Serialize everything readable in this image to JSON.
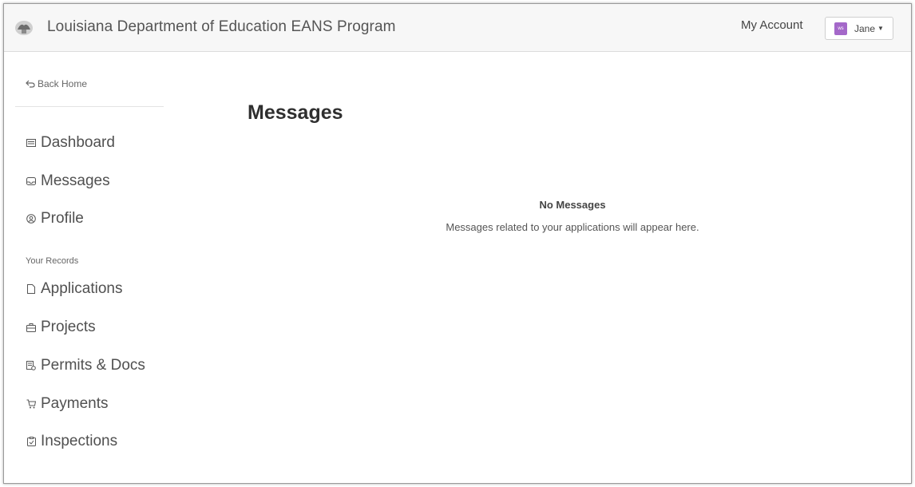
{
  "header": {
    "app_title": "Louisiana Department of Education EANS Program",
    "my_account": "My Account",
    "user_name": "Jane",
    "avatar_initials": "ws",
    "avatar_color": "#a468c9"
  },
  "sidebar": {
    "back_home": "Back Home",
    "primary_items": [
      {
        "label": "Dashboard",
        "icon": "dashboard-icon"
      },
      {
        "label": "Messages",
        "icon": "inbox-icon"
      },
      {
        "label": "Profile",
        "icon": "user-circle-icon"
      }
    ],
    "section_label": "Your Records",
    "record_items": [
      {
        "label": "Applications",
        "icon": "document-icon"
      },
      {
        "label": "Projects",
        "icon": "briefcase-icon"
      },
      {
        "label": "Permits & Docs",
        "icon": "permit-icon"
      },
      {
        "label": "Payments",
        "icon": "cart-icon"
      },
      {
        "label": "Inspections",
        "icon": "clipboard-icon"
      }
    ]
  },
  "main": {
    "title": "Messages",
    "empty_title": "No Messages",
    "empty_message": "Messages related to your applications will appear here."
  }
}
